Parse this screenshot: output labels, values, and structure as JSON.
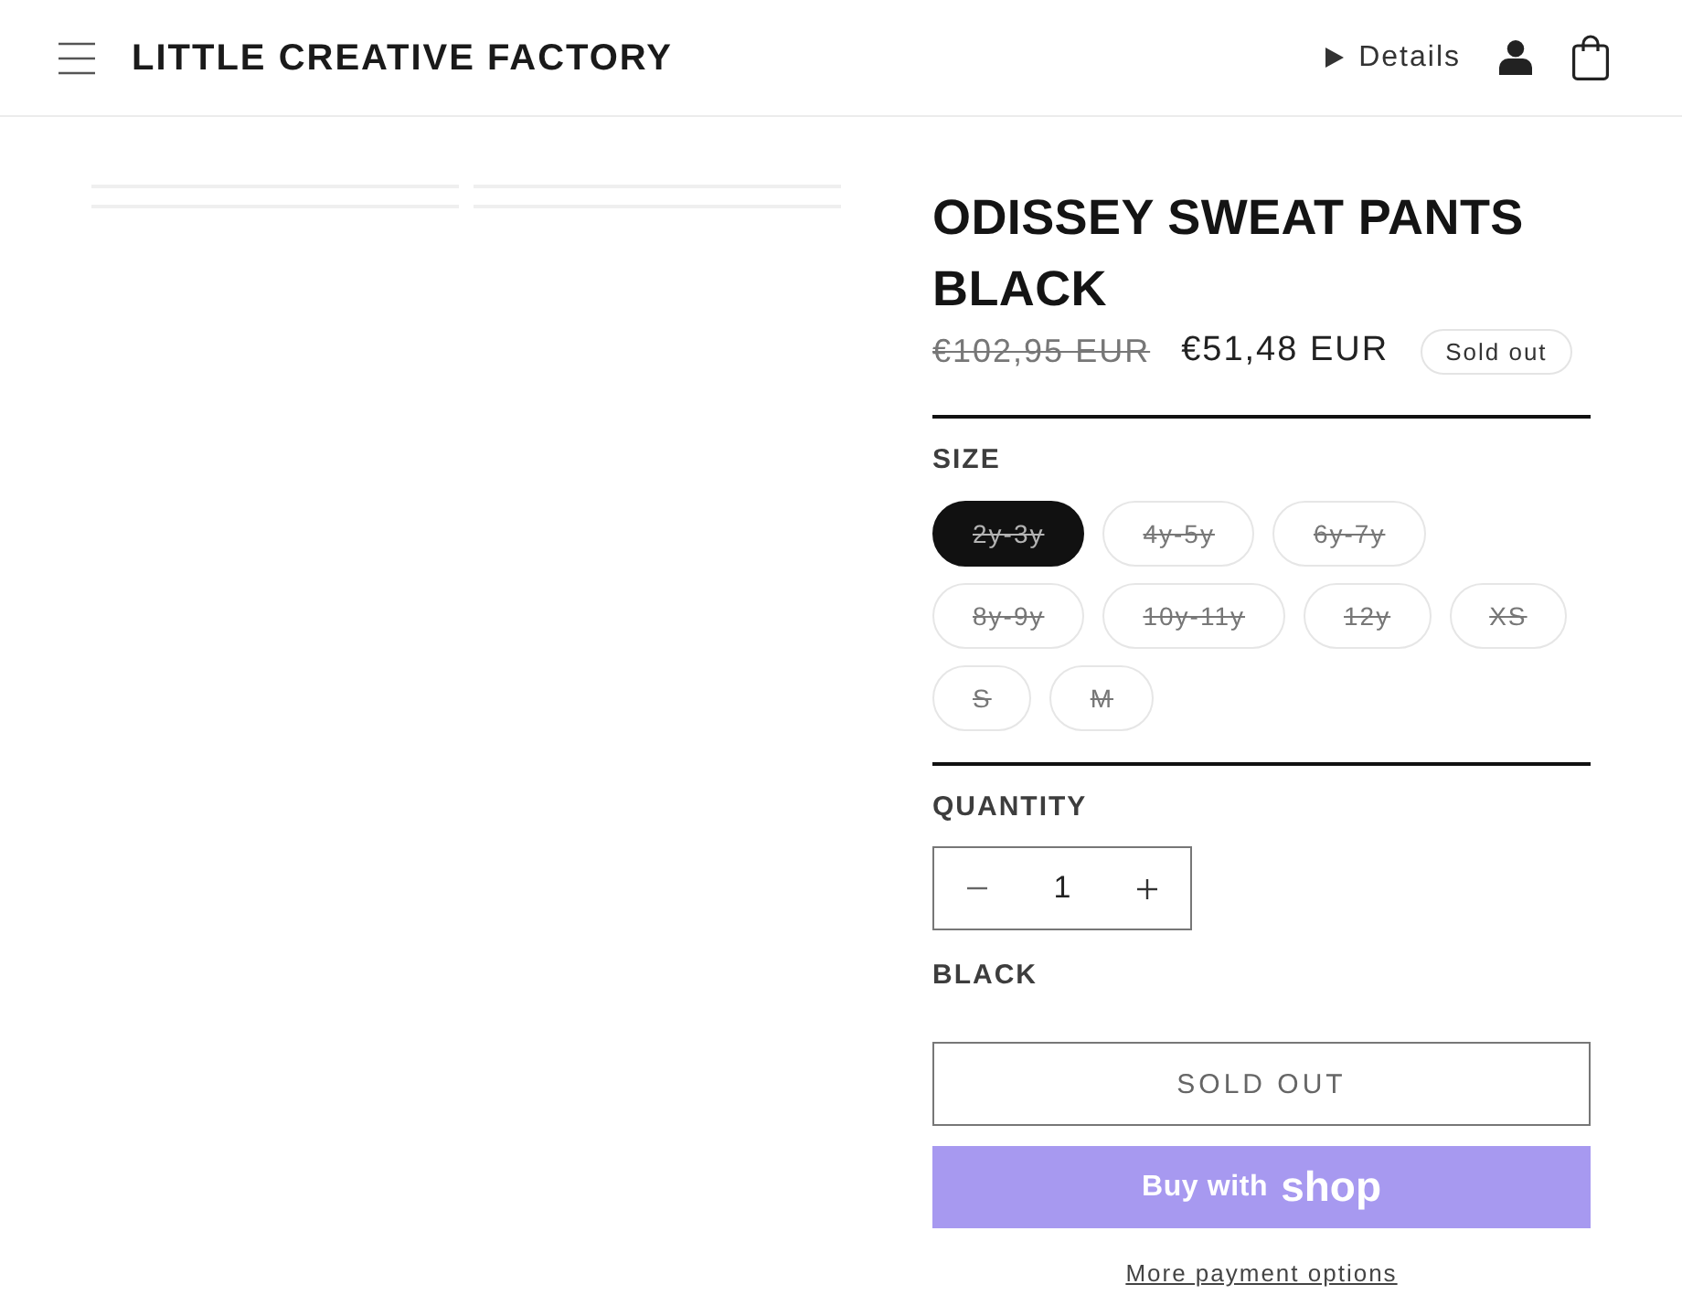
{
  "header": {
    "logo": "LITTLE CREATIVE FACTORY",
    "details": {
      "label": "Details",
      "expanded": false
    }
  },
  "product": {
    "title": "ODISSEY SWEAT PANTS BLACK",
    "regular_price": "€102,95 EUR",
    "sale_price": "€51,48 EUR",
    "badge": "Sold out"
  },
  "size": {
    "label": "SIZE",
    "options": [
      {
        "label": "2y-3y",
        "selected": true,
        "unavailable": true
      },
      {
        "label": "4y-5y",
        "selected": false,
        "unavailable": true
      },
      {
        "label": "6y-7y",
        "selected": false,
        "unavailable": true
      },
      {
        "label": "8y-9y",
        "selected": false,
        "unavailable": true
      },
      {
        "label": "10y-11y",
        "selected": false,
        "unavailable": true
      },
      {
        "label": "12y",
        "selected": false,
        "unavailable": true
      },
      {
        "label": "XS",
        "selected": false,
        "unavailable": true
      },
      {
        "label": "S",
        "selected": false,
        "unavailable": true
      },
      {
        "label": "M",
        "selected": false,
        "unavailable": true
      }
    ]
  },
  "quantity": {
    "label": "QUANTITY",
    "value": "1"
  },
  "color": {
    "label": "BLACK"
  },
  "sold_out_button": {
    "label": "SOLD OUT",
    "disabled": true
  },
  "shop_button": {
    "label": "Buy with",
    "brand": "shop"
  },
  "more_payment_link": "More payment options"
}
